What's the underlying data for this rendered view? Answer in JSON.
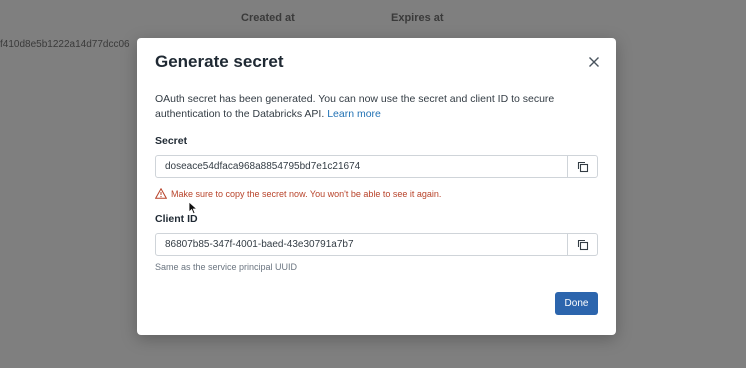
{
  "background": {
    "columns": [
      "Created at",
      "Expires at"
    ],
    "row_partial_id": "f410d8e5b1222a14d77dcc06"
  },
  "modal": {
    "title": "Generate secret",
    "close_icon": "close-icon",
    "description_text": "OAuth secret has been generated. You can now use the secret and client ID to secure authentication to the Databricks API.",
    "learn_more_label": "Learn more",
    "secret": {
      "label": "Secret",
      "value": "doseace54dfaca968a8854795bd7e1c21674",
      "copy_icon": "copy-icon"
    },
    "warning": {
      "icon": "warning-triangle-icon",
      "text": "Make sure to copy the secret now. You won't be able to see it again."
    },
    "client_id": {
      "label": "Client ID",
      "value": "86807b85-347f-4001-baed-43e30791a7b7",
      "hint": "Same as the service principal UUID",
      "copy_icon": "copy-icon"
    },
    "done_label": "Done"
  },
  "colors": {
    "primary": "#2c65ad",
    "link": "#2272b4",
    "warning": "#b8432a",
    "backdrop": "#7f7f7f"
  }
}
